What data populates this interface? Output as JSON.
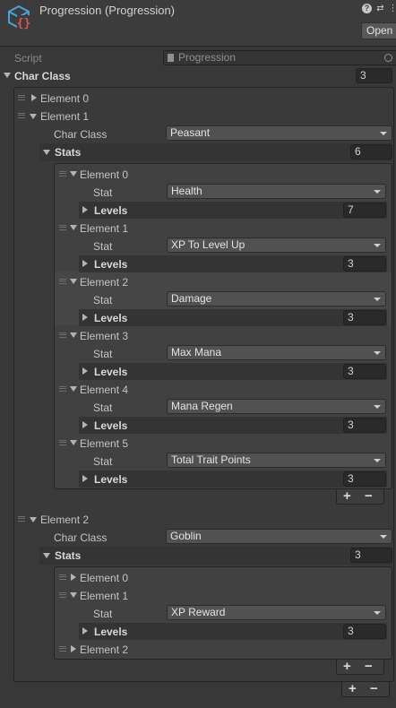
{
  "header": {
    "title": "Progression (Progression)",
    "open_label": "Open",
    "help_icon": "?",
    "settings_icon": "⇄",
    "more_icon": "⋮"
  },
  "script": {
    "label": "Script",
    "value": "Progression"
  },
  "char_class_array": {
    "label": "Char Class",
    "size": "3"
  },
  "footer": {
    "add": "+",
    "remove": "−"
  },
  "elements": [
    {
      "label": "Element 0"
    },
    {
      "label": "Element 1",
      "char_class_label": "Char Class",
      "char_class_value": "Peasant",
      "stats_label": "Stats",
      "stats_size": "6",
      "stats": [
        {
          "label": "Element 0",
          "stat_label": "Stat",
          "stat_value": "Health",
          "levels_label": "Levels",
          "levels_size": "7"
        },
        {
          "label": "Element 1",
          "stat_label": "Stat",
          "stat_value": "XP To Level Up",
          "levels_label": "Levels",
          "levels_size": "3"
        },
        {
          "label": "Element 2",
          "stat_label": "Stat",
          "stat_value": "Damage",
          "levels_label": "Levels",
          "levels_size": "3"
        },
        {
          "label": "Element 3",
          "stat_label": "Stat",
          "stat_value": "Max Mana",
          "levels_label": "Levels",
          "levels_size": "3"
        },
        {
          "label": "Element 4",
          "stat_label": "Stat",
          "stat_value": "Mana Regen",
          "levels_label": "Levels",
          "levels_size": "3"
        },
        {
          "label": "Element 5",
          "stat_label": "Stat",
          "stat_value": "Total Trait Points",
          "levels_label": "Levels",
          "levels_size": "3"
        }
      ]
    },
    {
      "label": "Element 2",
      "char_class_label": "Char Class",
      "char_class_value": "Goblin",
      "stats_label": "Stats",
      "stats_size": "3",
      "stats": [
        {
          "label": "Element 0"
        },
        {
          "label": "Element 1",
          "stat_label": "Stat",
          "stat_value": "XP Reward",
          "levels_label": "Levels",
          "levels_size": "3"
        },
        {
          "label": "Element 2"
        }
      ]
    }
  ]
}
